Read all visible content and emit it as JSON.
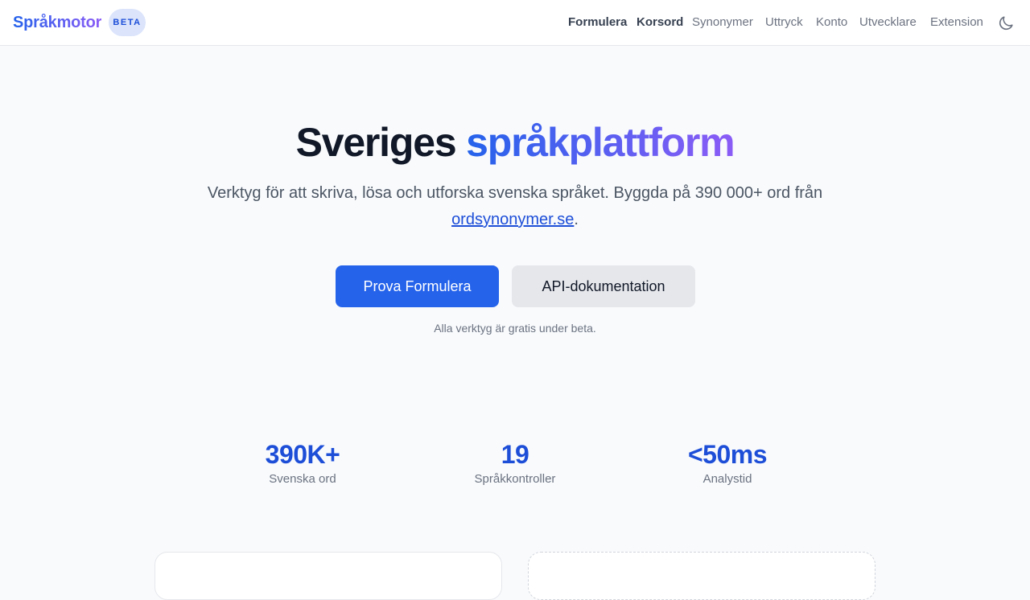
{
  "header": {
    "brand": "Språkmotor",
    "badge": "BETA",
    "nav": [
      {
        "label": "Formulera",
        "active": true
      },
      {
        "label": "Korsord",
        "active": true
      },
      {
        "label": "Synonymer",
        "active": false
      },
      {
        "label": "Uttryck",
        "active": false
      },
      {
        "label": "Konto",
        "active": false
      },
      {
        "label": "Utvecklare",
        "active": false
      },
      {
        "label": "Extension",
        "active": false
      }
    ],
    "theme_toggle_icon": "moon-icon"
  },
  "hero": {
    "title_plain": "Sveriges",
    "title_highlight": "språkplattform",
    "subtitle_before_link": "Verktyg för att skriva, lösa och utforska svenska språket. Byggda på 390 000+ ord från ",
    "subtitle_link": "ordsynonymer.se",
    "subtitle_after_link": ".",
    "primary_button": "Prova Formulera",
    "secondary_button": "API-dokumentation",
    "note": "Alla verktyg är gratis under beta."
  },
  "stats": [
    {
      "value": "390K+",
      "label": "Svenska ord"
    },
    {
      "value": "19",
      "label": "Språkkontroller"
    },
    {
      "value": "<50ms",
      "label": "Analystid"
    }
  ],
  "colors": {
    "accent": "#2563eb",
    "gradient_end": "#8b5cf6",
    "stat_value": "#1d4ed8",
    "background": "#f8fafc"
  }
}
